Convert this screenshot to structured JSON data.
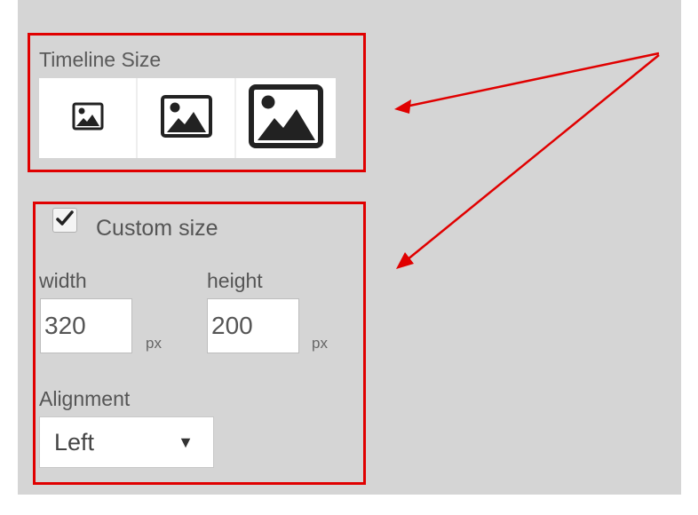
{
  "timeline_size": {
    "title": "Timeline Size",
    "options": [
      {
        "icon": "image-small-icon"
      },
      {
        "icon": "image-medium-icon"
      },
      {
        "icon": "image-large-icon",
        "selected": true
      }
    ]
  },
  "custom_size": {
    "checked": true,
    "label": "Custom size",
    "width_label": "width",
    "width_value": "320",
    "width_unit": "px",
    "height_label": "height",
    "height_value": "200",
    "height_unit": "px"
  },
  "alignment": {
    "label": "Alignment",
    "selected": "Left",
    "arrow": "▼"
  },
  "colors": {
    "annotation": "#e00000",
    "panel": "#d5d5d5"
  }
}
